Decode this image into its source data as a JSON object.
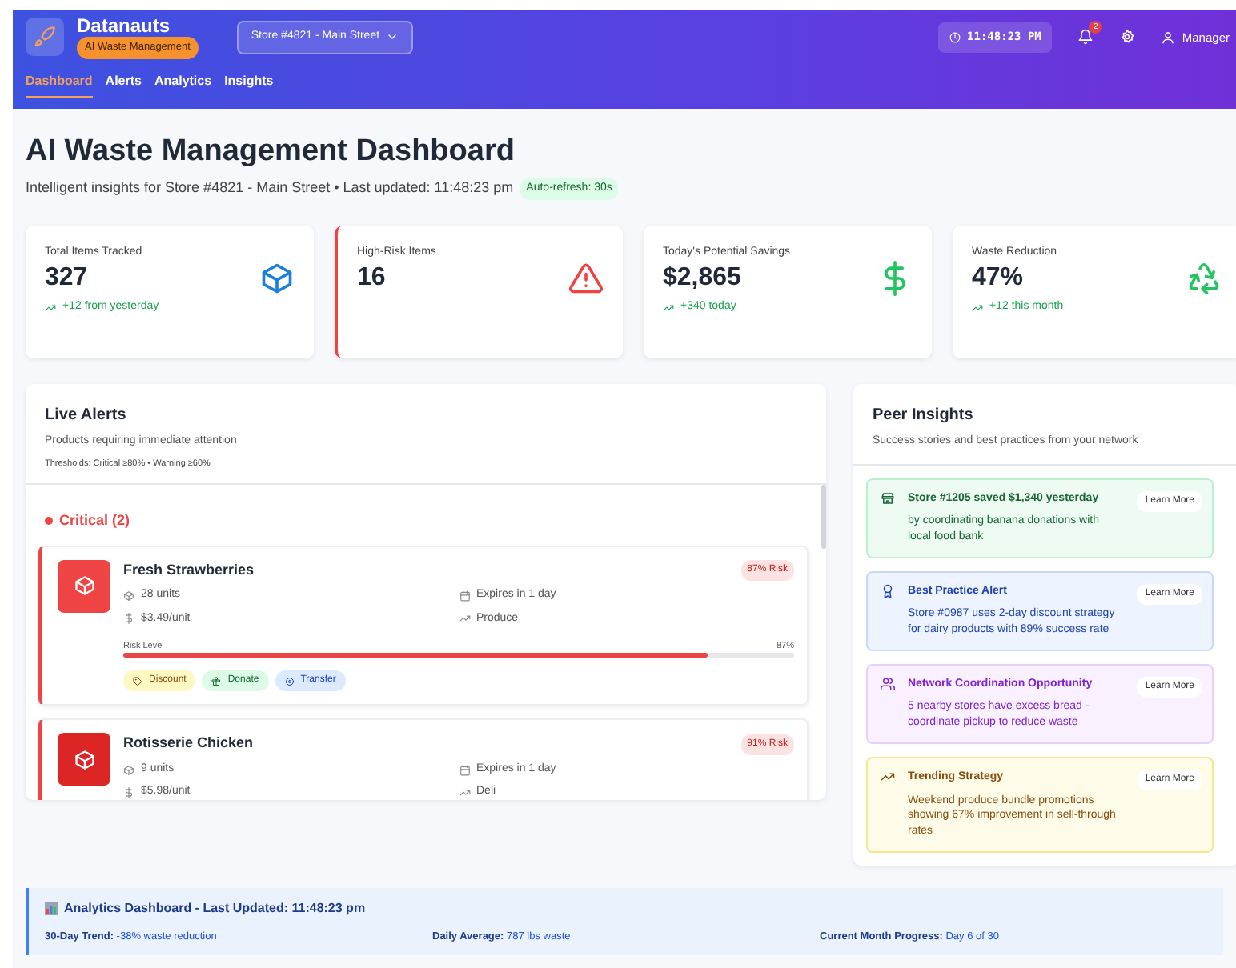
{
  "header": {
    "brand": "Datanauts",
    "badge": "AI Waste Management",
    "store": "Store #4821 - Main Street",
    "time": "11:48:23 PM",
    "notifications": "2",
    "user": "Manager"
  },
  "nav": [
    {
      "label": "Dashboard",
      "selected": true
    },
    {
      "label": "Alerts",
      "selected": false
    },
    {
      "label": "Analytics",
      "selected": false
    },
    {
      "label": "Insights",
      "selected": false
    }
  ],
  "title": "AI Waste Management Dashboard",
  "subtitle": "Intelligent insights for Store #4821 - Main Street • Last updated: 11:48:23 pm",
  "auto_refresh": "Auto-refresh: 30s",
  "stats": [
    {
      "label": "Total Items Tracked",
      "value": "327",
      "change": "+12 from yesterday",
      "kind": "box",
      "alert": false
    },
    {
      "label": "High-Risk Items",
      "value": "16",
      "kind": "warning",
      "alert": true
    },
    {
      "label": "Today's Potential Savings",
      "value": "$2,865",
      "change": "+340 today",
      "kind": "dollar",
      "alert": false
    },
    {
      "label": "Waste Reduction",
      "value": "47%",
      "change": "+12 this month",
      "kind": "recycle",
      "alert": false
    }
  ],
  "live_alerts": {
    "title": "Live Alerts",
    "subtitle": "Products requiring immediate attention",
    "thresholds": "Thresholds: Critical ≥80% • Warning ≥60%",
    "group": "Critical (2)",
    "items": [
      {
        "name": "Fresh Strawberries",
        "risk": "87% Risk",
        "units": "28 units",
        "expires": "Expires in 1 day",
        "price": "$3.49/unit",
        "category": "Produce",
        "color": "#ef4444",
        "risk_label": "Risk Level",
        "risk_reading": "87%",
        "level": 0.87,
        "actions": [
          {
            "label": "Discount",
            "kind": "discount"
          },
          {
            "label": "Donate",
            "kind": "donate"
          },
          {
            "label": "Transfer",
            "kind": "transfer"
          }
        ]
      },
      {
        "name": "Rotisserie Chicken",
        "risk": "91% Risk",
        "units": "9 units",
        "expires": "Expires in 1 day",
        "price": "$5.98/unit",
        "category": "Deli",
        "color": "#dc2626"
      }
    ]
  },
  "peer_insights": {
    "title": "Peer Insights",
    "subtitle": "Success stories and best practices from your network",
    "items": [
      {
        "kind": "success",
        "title": "Store #1205 saved $1,340 yesterday",
        "text": "by coordinating banana donations with local food bank",
        "button": "Learn More"
      },
      {
        "kind": "practice",
        "title": "Best Practice Alert",
        "text": "Store #0987 uses 2-day discount strategy for dairy products with 89% success rate",
        "button": "Learn More"
      },
      {
        "kind": "network",
        "title": "Network Coordination Opportunity",
        "text": "5 nearby stores have excess bread - coordinate pickup to reduce waste",
        "button": "Learn More"
      },
      {
        "kind": "trend",
        "title": "Trending Strategy",
        "text": "Weekend produce bundle promotions showing 67% improvement in sell-through rates",
        "button": "Learn More"
      }
    ]
  },
  "analytics": {
    "title": "Analytics Dashboard - Last Updated: 11:48:23 pm",
    "stats": [
      "**30-Day Trend:** -38% waste reduction",
      "**Daily Average:** 787 lbs waste",
      "**Current Month Progress:** Day 6 of 30"
    ]
  }
}
